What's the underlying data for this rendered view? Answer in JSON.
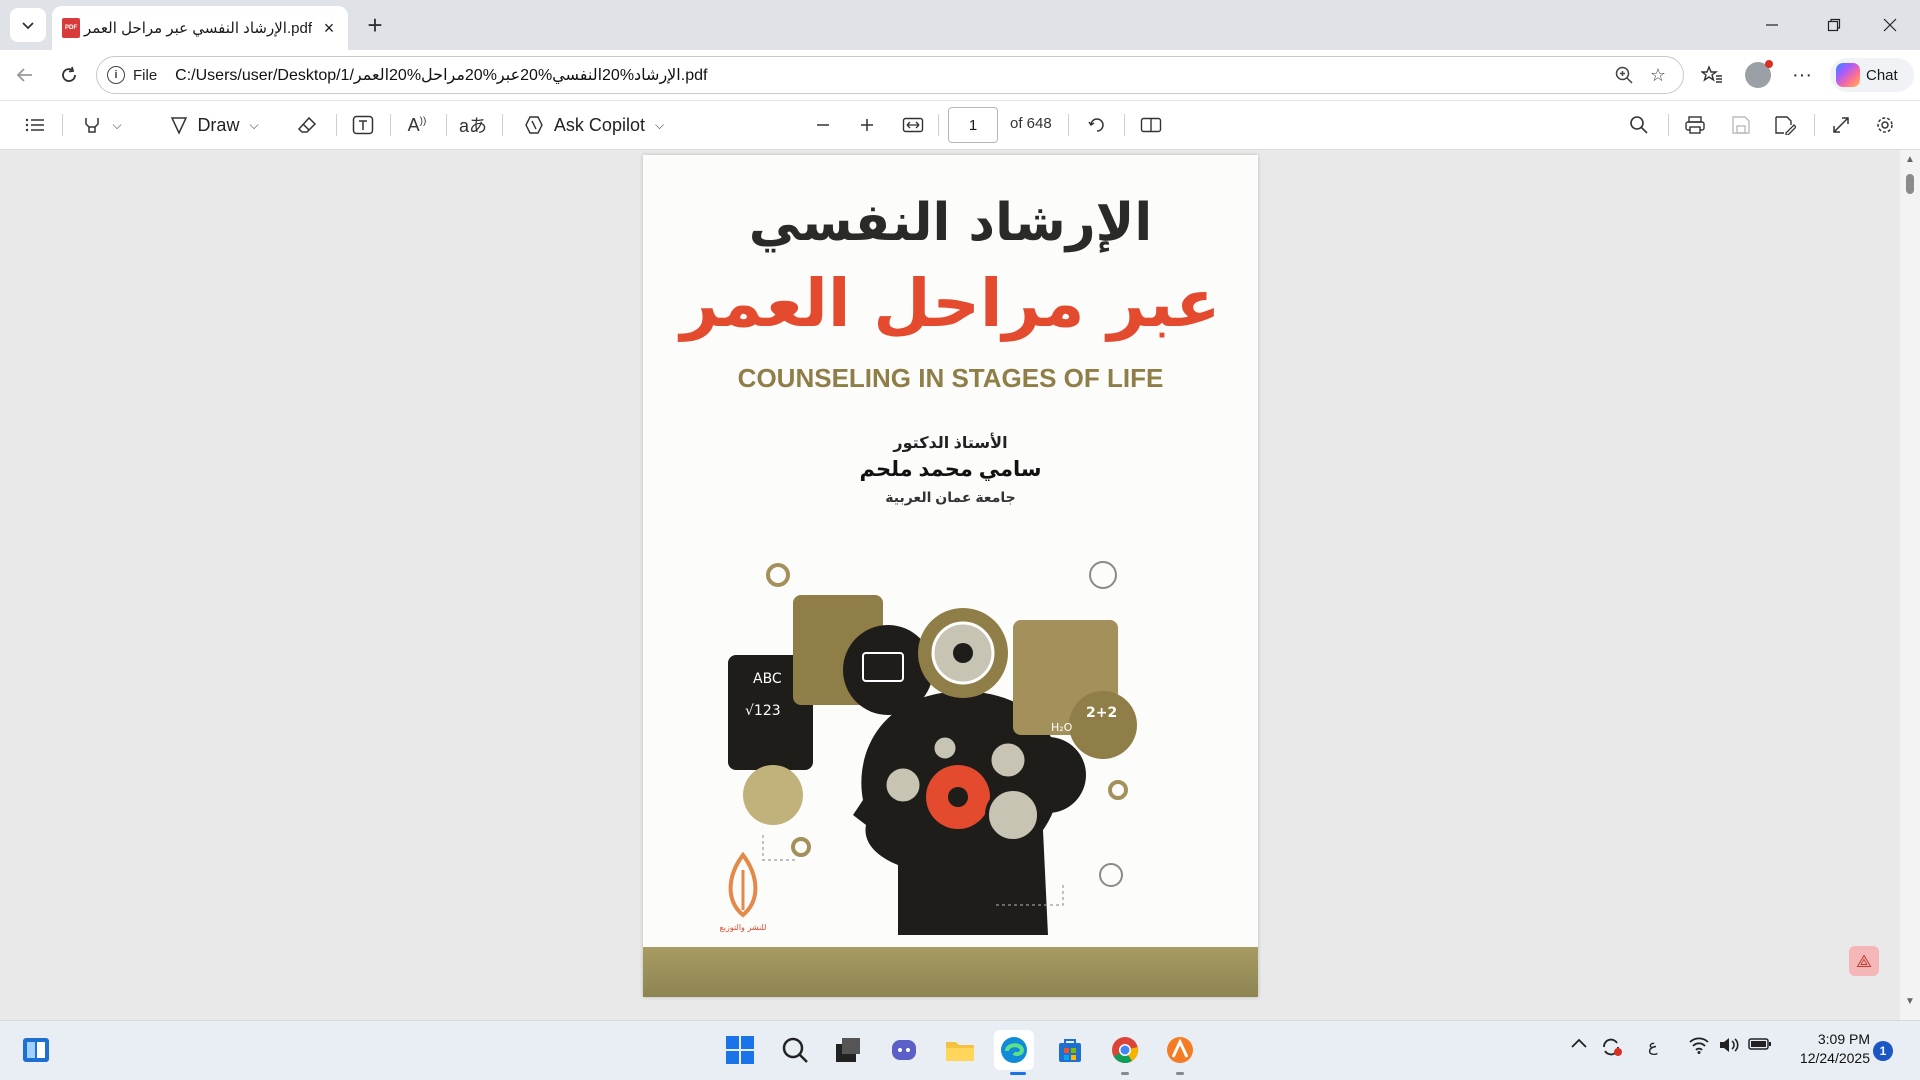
{
  "browser": {
    "tab_title": "الإرشاد النفسي عبر مراحل العمر.pdf",
    "pdf_badge": "PDF",
    "address_prefix": "File",
    "url": "C:/Users/user/Desktop/1/الإرشاد%20النفسي%20عبر%20مراحل%20العمر.pdf",
    "chat_label": "Chat"
  },
  "pdf_toolbar": {
    "draw_label": "Draw",
    "ask_copilot_label": "Ask Copilot",
    "page_number": "1",
    "page_total_label": "of 648"
  },
  "book": {
    "title_line1": "الإرشاد النفسي",
    "title_line2": "عبر مراحل العمر",
    "title_english": "COUNSELING IN STAGES OF LIFE",
    "author_prefix": "الأستاذ الدكتور",
    "author_name": "سامي محمد ملحم",
    "university": "جامعة عمان العربية",
    "publisher_text": "للنشر والتوزيع",
    "art_labels": {
      "abc": "ABC",
      "sqrt": "√123",
      "sum": "2+2",
      "h2o": "H₂O"
    }
  },
  "taskbar": {
    "lang_indicator": "ع",
    "time": "3:09 PM",
    "date": "12/24/2025",
    "notification_count": "1"
  },
  "colors": {
    "title_red": "#e34a2e",
    "title_gold": "#8f7e47",
    "accent_blue": "#1a56c4"
  }
}
